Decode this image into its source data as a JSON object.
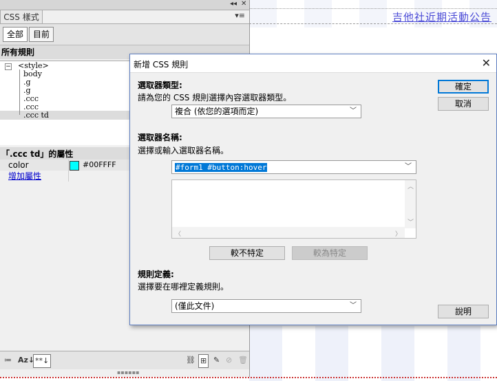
{
  "background": {
    "link_text": "吉他社近期活動公告"
  },
  "panel": {
    "tab_label": "CSS 樣式",
    "collapse_glyph": "◂◂",
    "close_glyph": "✕",
    "menu_glyph": "▾≡",
    "toggle_all": "全部",
    "toggle_current": "目前",
    "rules_heading": "所有規則",
    "tree": {
      "expander": "−",
      "root": "<style>",
      "items": [
        "body",
        ".g",
        ".g",
        ".ccc",
        ".ccc",
        ".ccc td"
      ]
    },
    "props_heading": "「.ccc td」的屬性",
    "props": [
      {
        "name": "color",
        "value": "#00FFFF",
        "swatch": "#00FFFF"
      }
    ],
    "add_property": "增加屬性",
    "footer": {
      "show_category": "≔",
      "sort_az": "Az↓",
      "show_set": "**↓",
      "attach": "⛓",
      "new_rule": "⊞",
      "edit": "✎",
      "disable": "⊘",
      "delete": "🗑"
    }
  },
  "dialog": {
    "title": "新增 CSS 規則",
    "close_glyph": "✕",
    "selector_type_label": "選取器類型:",
    "selector_type_hint": "請為您的 CSS 規則選擇內容選取器類型。",
    "selector_type_value": "複合 (依您的選項而定)",
    "selector_name_label": "選取器名稱:",
    "selector_name_hint": "選擇或輸入選取器名稱。",
    "selector_name_value": "#form1 #button:hover",
    "less_specific": "較不特定",
    "more_specific": "較為特定",
    "rule_def_label": "規則定義:",
    "rule_def_hint": "選擇要在哪裡定義規則。",
    "rule_def_value": "(僅此文件)",
    "ok_label": "確定",
    "cancel_label": "取消",
    "help_label": "說明"
  }
}
